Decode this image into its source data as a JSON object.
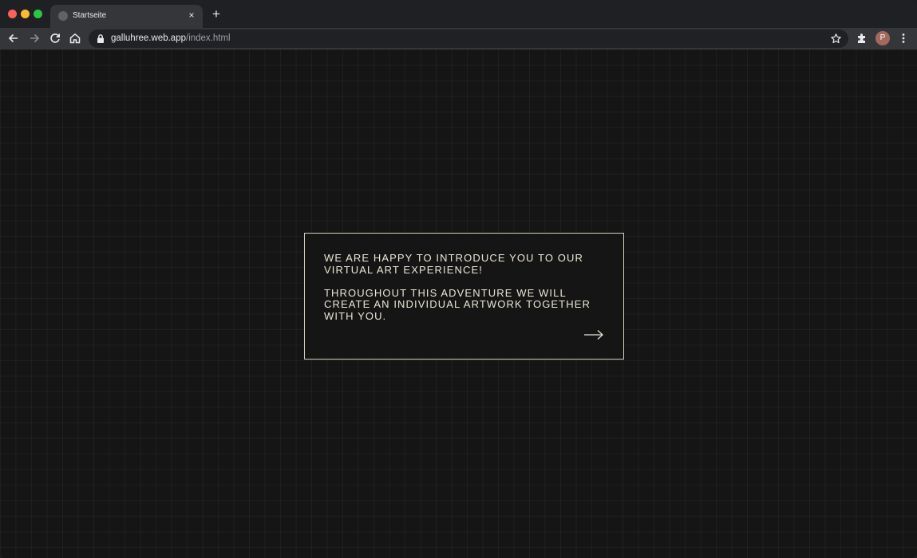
{
  "browser": {
    "tab_title": "Startseite",
    "tab_close": "×",
    "new_tab": "+",
    "url_host": "galluhree.web.app",
    "url_path": "/index.html",
    "profile_initial": "P"
  },
  "page": {
    "paragraph_1": "WE ARE HAPPY TO INTRODUCE YOU TO OUR VIRTUAL ART EXPERIENCE!",
    "paragraph_2": "THROUGHOUT THIS ADVENTURE WE WILL CREATE AN INDIVIDUAL ARTWORK TOGETHER WITH YOU.",
    "next_icon": "arrow-right-icon"
  },
  "colors": {
    "page_background": "#151515",
    "card_border": "#d8d0bc",
    "card_text": "#ece6d6",
    "toolbar": "#35363a"
  }
}
